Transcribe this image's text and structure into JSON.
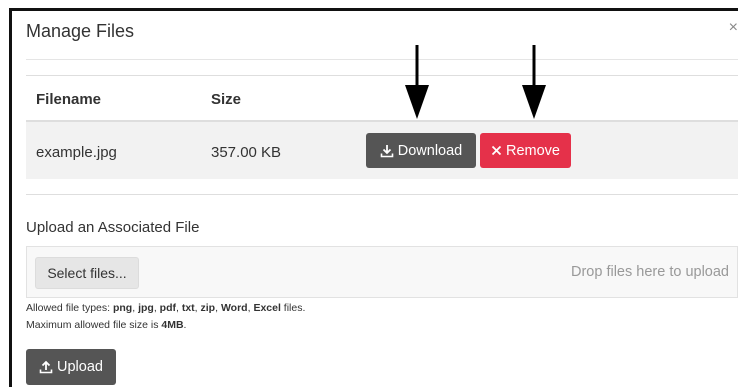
{
  "dialog": {
    "title": "Manage Files",
    "close_glyph": "×"
  },
  "table": {
    "headers": [
      "Filename",
      "Size"
    ],
    "rows": [
      {
        "filename": "example.jpg",
        "size": "357.00 KB",
        "download_label": "Download",
        "remove_label": "Remove"
      }
    ]
  },
  "upload": {
    "section_label": "Upload an Associated File",
    "select_button": "Select files...",
    "drop_hint": "Drop files here to upload",
    "allowed_prefix": "Allowed file types: ",
    "allowed_types": [
      "png",
      "jpg",
      "pdf",
      "txt",
      "zip",
      "Word",
      "Excel"
    ],
    "allowed_suffix": " files.",
    "max_prefix": "Maximum allowed file size is ",
    "max_size": "4MB",
    "max_suffix": ".",
    "upload_button": "Upload"
  },
  "icons": {
    "download": "download-icon",
    "remove": "x-icon",
    "upload": "upload-icon",
    "close": "close-icon"
  },
  "colors": {
    "dark_button": "#555555",
    "remove_button": "#e5314a",
    "row_highlight": "#f2f2f2"
  }
}
